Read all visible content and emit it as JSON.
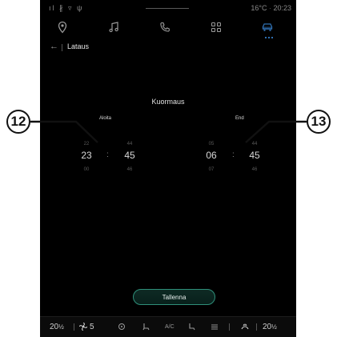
{
  "status_bar": {
    "left_icons": "ıl ∦ ▿ ψ",
    "temperature": "16°C",
    "time": "20:23"
  },
  "nav_tabs": [
    {
      "name": "navigation",
      "icon": "location-pin-icon"
    },
    {
      "name": "music",
      "icon": "music-note-icon"
    },
    {
      "name": "phone",
      "icon": "phone-icon"
    },
    {
      "name": "apps",
      "icon": "apps-grid-icon"
    },
    {
      "name": "vehicle",
      "icon": "car-icon",
      "active": true
    }
  ],
  "header": {
    "back_glyph": "←",
    "title": "Lataus"
  },
  "main": {
    "section_title": "Kuormaus",
    "start": {
      "label": "Aloita",
      "hour_prev": "22",
      "hour": "23",
      "hour_next": "00",
      "min_prev": "44",
      "min": "45",
      "min_next": "46"
    },
    "end": {
      "label": "End",
      "hour_prev": "05",
      "hour": "06",
      "hour_next": "07",
      "min_prev": "44",
      "min": "45",
      "min_next": "46"
    },
    "separator": ":",
    "save_label": "Tallenna"
  },
  "bottom_bar": {
    "left_temp": "20",
    "left_temp_unit": "½",
    "fan_level": "5",
    "ac_label": "A/C",
    "right_temp": "20",
    "right_temp_unit": "½"
  },
  "callouts": {
    "left": "12",
    "right": "13"
  },
  "colors": {
    "accent_active": "#2f6fb1",
    "save_border": "#2f8f7a",
    "screen_bg": "#000000"
  }
}
